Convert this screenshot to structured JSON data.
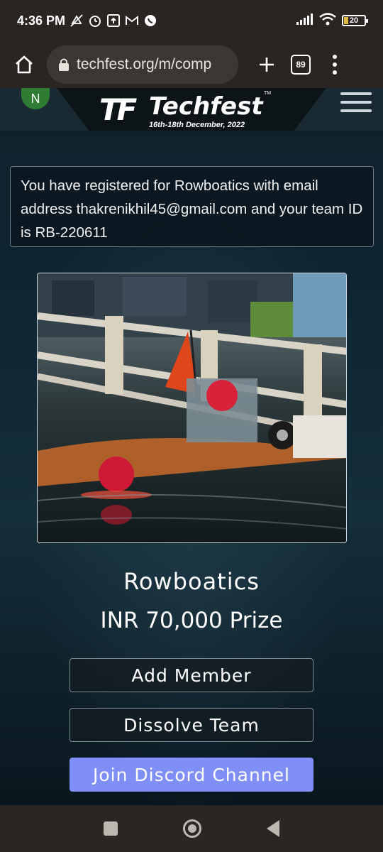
{
  "status_bar": {
    "time": "4:36 PM",
    "battery_level": "20",
    "icons_left": [
      "mute-icon",
      "alarm-icon",
      "upload-icon",
      "gmail-icon",
      "whatsapp-icon"
    ],
    "icons_right": [
      "signal-icon",
      "wifi-icon",
      "battery-icon"
    ]
  },
  "browser": {
    "url": "techfest.org/m/comp",
    "tab_count": "89"
  },
  "site": {
    "avatar_initial": "N",
    "logo_mark": "TF",
    "logo_word": "Techfest",
    "logo_tm": "TM",
    "logo_date": "16th-18th December, 2022"
  },
  "registration": {
    "message": "You have registered for Rowboatics with email address thakrenikhil45@gmail.com and your team ID is RB-220611"
  },
  "competition": {
    "name": "Rowboatics",
    "prize": "INR 70,000 Prize"
  },
  "buttons": {
    "add_member": "Add Member",
    "dissolve_team": "Dissolve Team",
    "join_discord": "Join Discord Channel"
  },
  "colors": {
    "discord_button": "#7f8ff5",
    "avatar": "#2e7d32",
    "browser_chrome": "#2a2522"
  }
}
